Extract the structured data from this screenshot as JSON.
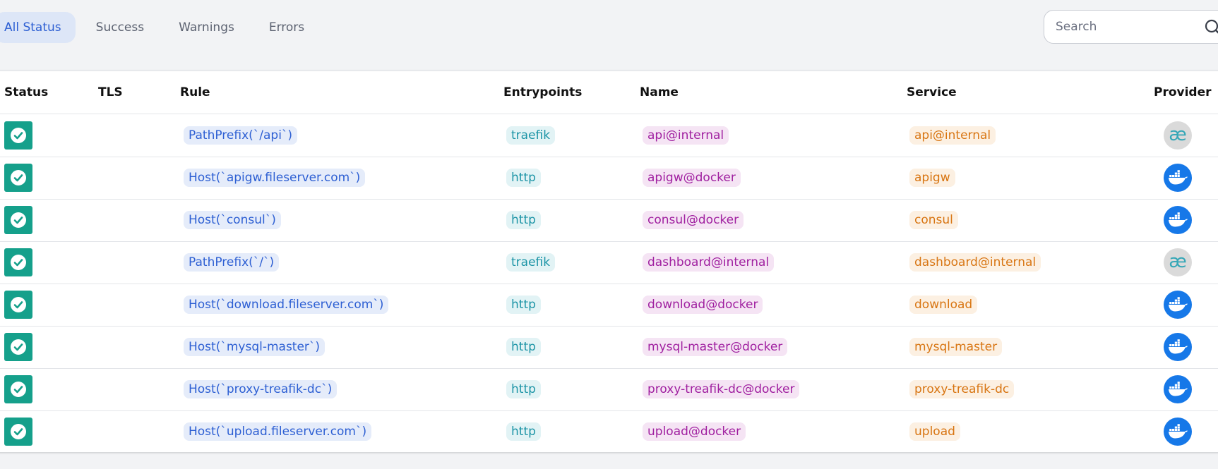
{
  "filters": {
    "tabs": [
      {
        "label": "All Status",
        "active": true
      },
      {
        "label": "Success",
        "active": false
      },
      {
        "label": "Warnings",
        "active": false
      },
      {
        "label": "Errors",
        "active": false
      }
    ]
  },
  "search": {
    "placeholder": "Search",
    "value": "",
    "icon": "search-icon"
  },
  "table": {
    "columns": [
      "Status",
      "TLS",
      "Rule",
      "Entrypoints",
      "Name",
      "Service",
      "Provider"
    ],
    "rows": [
      {
        "status": "success",
        "tls": "",
        "rule": "PathPrefix(`/api`)",
        "entrypoints": "traefik",
        "name": "api@internal",
        "service": "api@internal",
        "provider": "internal"
      },
      {
        "status": "success",
        "tls": "",
        "rule": "Host(`apigw.fileserver.com`)",
        "entrypoints": "http",
        "name": "apigw@docker",
        "service": "apigw",
        "provider": "docker"
      },
      {
        "status": "success",
        "tls": "",
        "rule": "Host(`consul`)",
        "entrypoints": "http",
        "name": "consul@docker",
        "service": "consul",
        "provider": "docker"
      },
      {
        "status": "success",
        "tls": "",
        "rule": "PathPrefix(`/`)",
        "entrypoints": "traefik",
        "name": "dashboard@internal",
        "service": "dashboard@internal",
        "provider": "internal"
      },
      {
        "status": "success",
        "tls": "",
        "rule": "Host(`download.fileserver.com`)",
        "entrypoints": "http",
        "name": "download@docker",
        "service": "download",
        "provider": "docker"
      },
      {
        "status": "success",
        "tls": "",
        "rule": "Host(`mysql-master`)",
        "entrypoints": "http",
        "name": "mysql-master@docker",
        "service": "mysql-master",
        "provider": "docker"
      },
      {
        "status": "success",
        "tls": "",
        "rule": "Host(`proxy-treafik-dc`)",
        "entrypoints": "http",
        "name": "proxy-treafik-dc@docker",
        "service": "proxy-treafik-dc",
        "provider": "docker"
      },
      {
        "status": "success",
        "tls": "",
        "rule": "Host(`upload.fileserver.com`)",
        "entrypoints": "http",
        "name": "upload@docker",
        "service": "upload",
        "provider": "docker"
      }
    ]
  },
  "icons": {
    "status_success": "check-circle-icon",
    "provider_internal": "ae-icon",
    "provider_internal_glyph": "æ",
    "provider_docker": "docker-whale-icon"
  },
  "colors": {
    "active_tab_bg": "#dde6f7",
    "active_tab_text": "#2d5fd3",
    "status_success": "#15a08b",
    "rule_pill": "#2d5fd3",
    "entrypoint_pill": "#1c94a6",
    "name_pill": "#a020a0",
    "service_pill": "#d87512",
    "docker_blue": "#1678e8"
  }
}
